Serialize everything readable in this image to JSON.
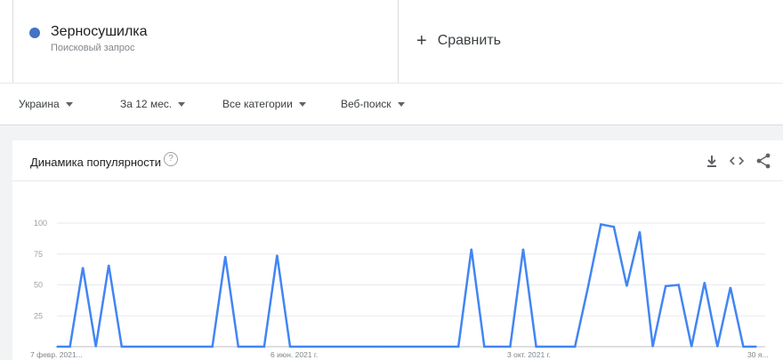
{
  "search": {
    "term": "Зерносушилка",
    "term_type": "Поисковый запрос",
    "term_color": "#4472c4",
    "compare_label": "Сравнить",
    "compare_icon": "plus-icon"
  },
  "filters": [
    {
      "label": "Украина"
    },
    {
      "label": "За 12 мес."
    },
    {
      "label": "Все категории"
    },
    {
      "label": "Веб-поиск"
    }
  ],
  "chart_card": {
    "title": "Динамика популярности",
    "help_icon": "help-circle-icon",
    "tools": [
      "download-icon",
      "embed-code-icon",
      "share-icon"
    ]
  },
  "chart_data": {
    "type": "line",
    "title": "",
    "xlabel": "",
    "ylabel": "",
    "ylim": [
      0,
      100
    ],
    "yticks": [
      25,
      50,
      75,
      100
    ],
    "grid": true,
    "x_tick_labels": [
      "7 февр. 2021...",
      "6 июн. 2021 г.",
      "3 окт. 2021 г.",
      "30 я..."
    ],
    "series": [
      {
        "color": "#4285f4",
        "values": [
          0,
          0,
          64,
          0,
          66,
          0,
          0,
          0,
          0,
          0,
          0,
          0,
          0,
          73,
          0,
          0,
          0,
          74,
          0,
          0,
          0,
          0,
          0,
          0,
          0,
          0,
          0,
          0,
          0,
          0,
          0,
          0,
          79,
          0,
          0,
          0,
          79,
          0,
          0,
          0,
          0,
          48,
          99,
          97,
          49,
          93,
          0,
          49,
          50,
          0,
          52,
          0,
          48,
          0,
          0
        ]
      }
    ]
  }
}
